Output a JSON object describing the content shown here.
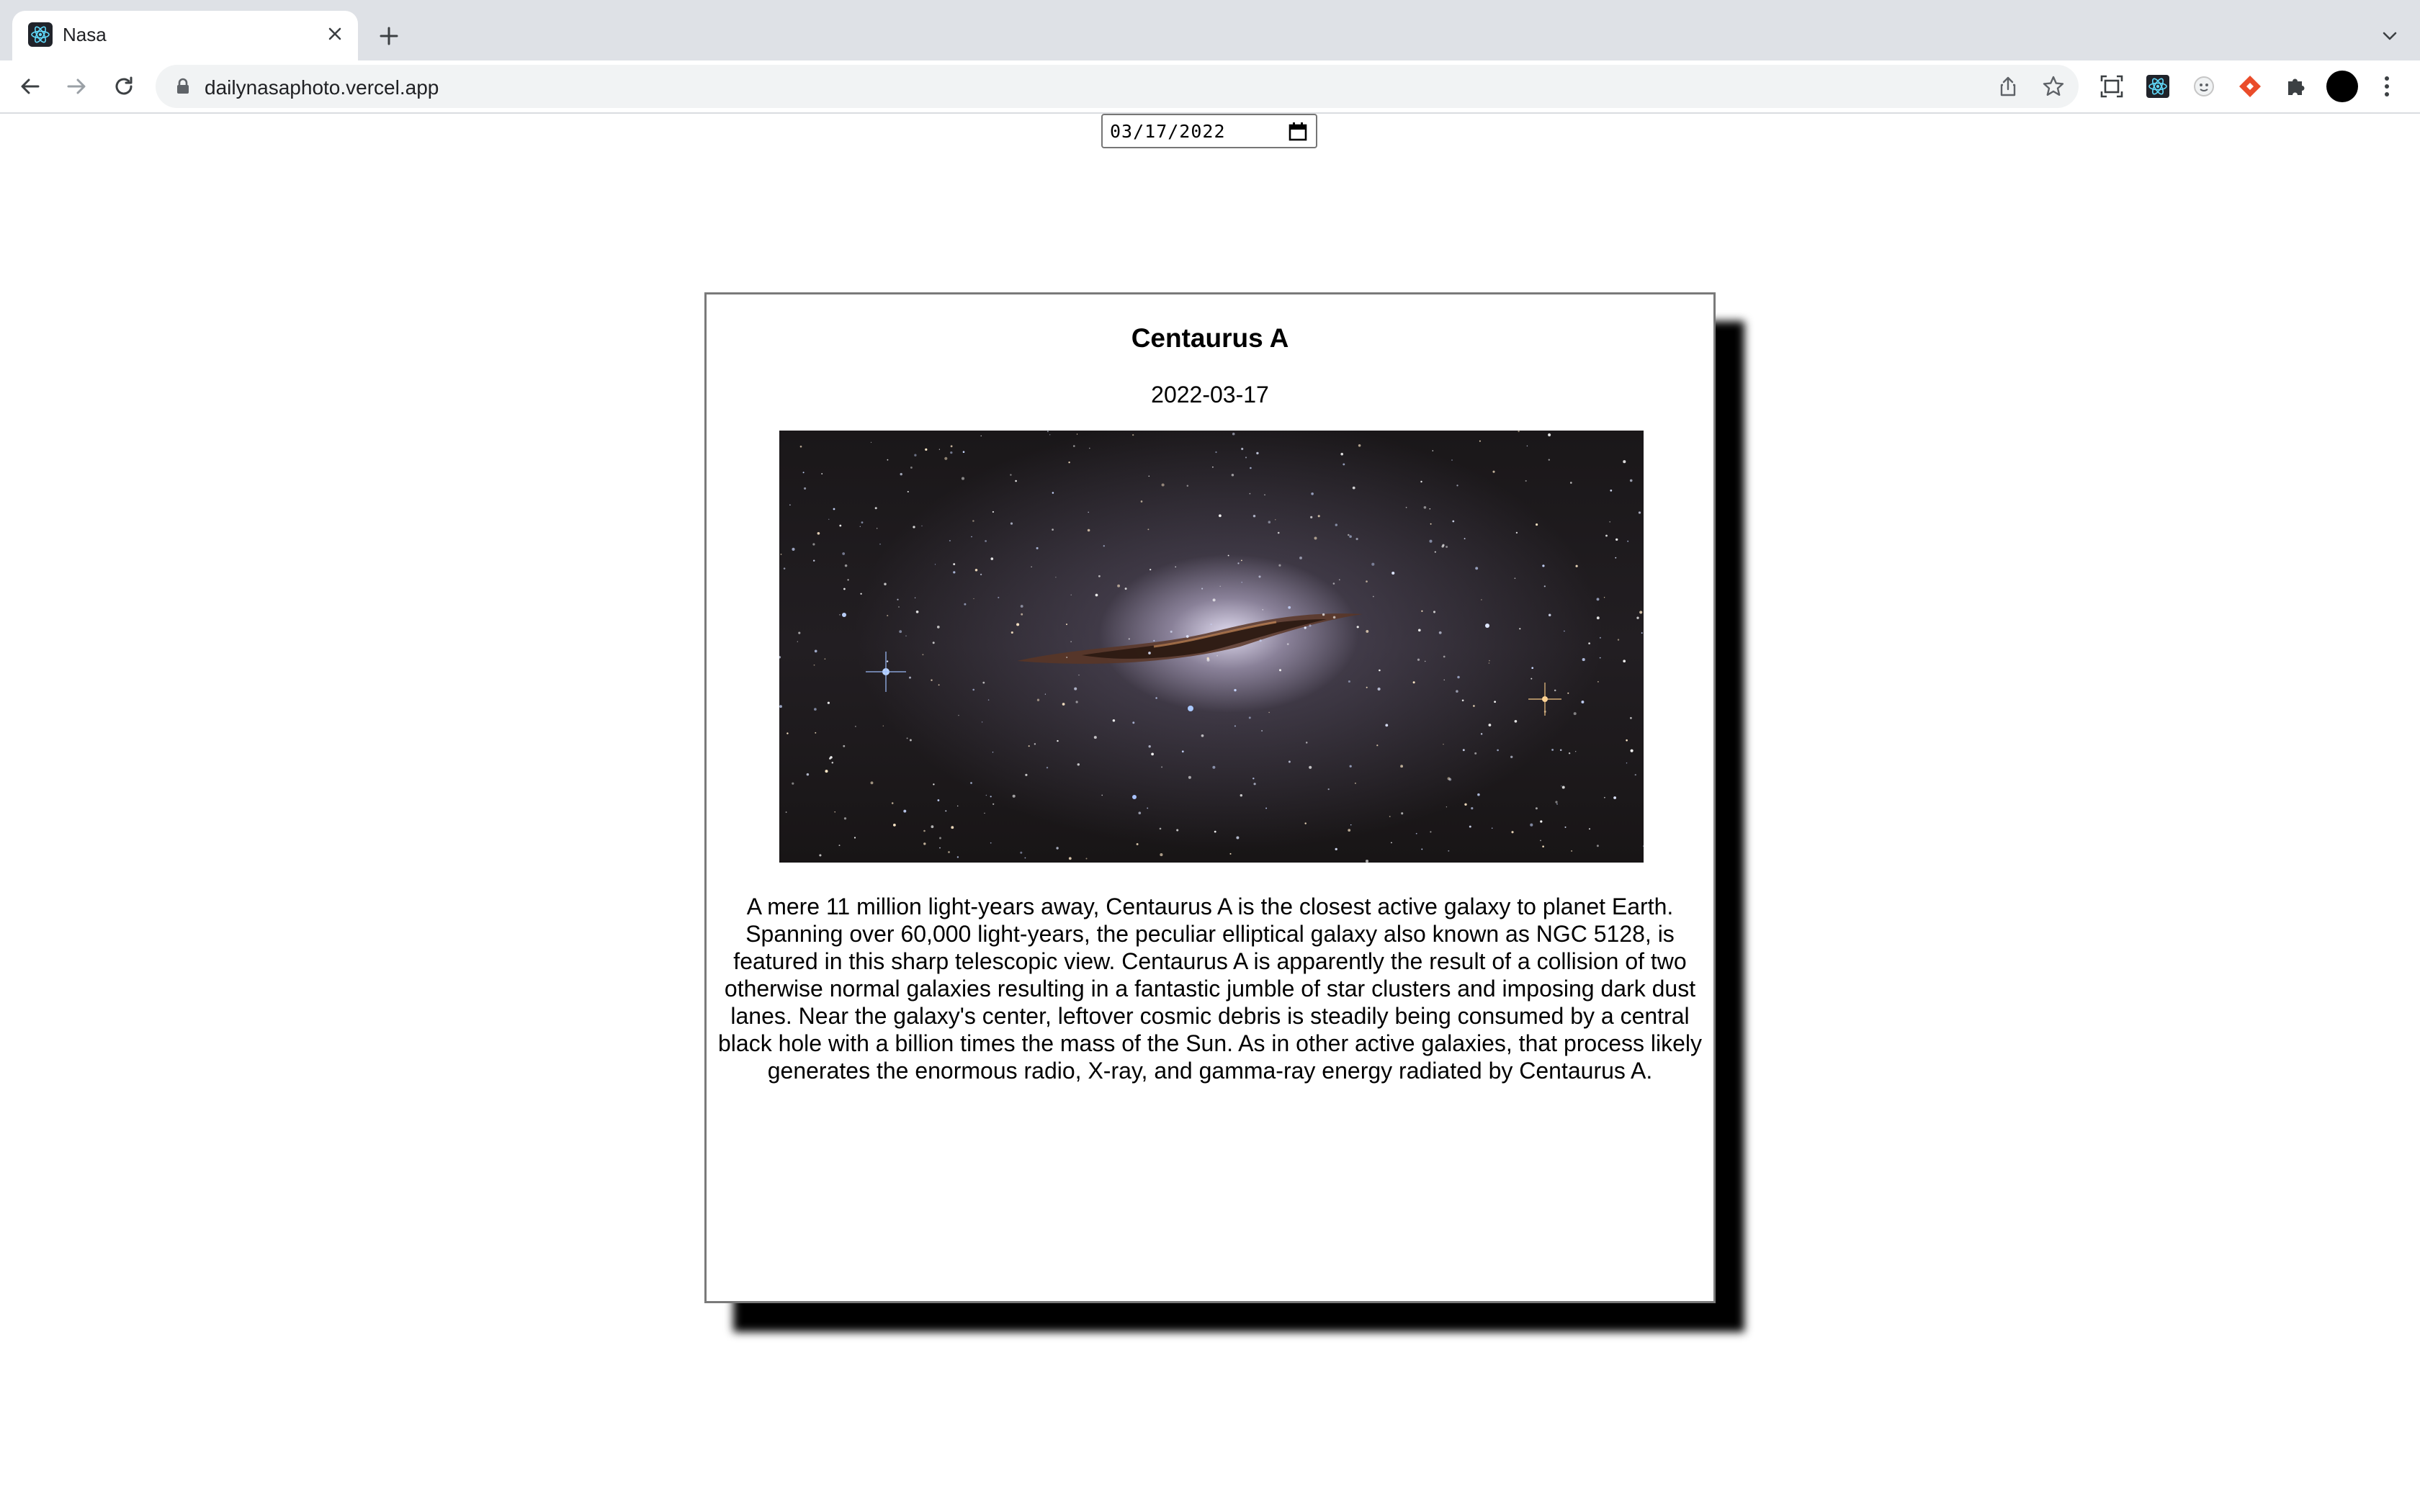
{
  "browser": {
    "tab": {
      "title": "Nasa",
      "favicon_icon": "react-atom-icon"
    },
    "address_bar": {
      "url": "dailynasaphoto.vercel.app"
    }
  },
  "page": {
    "date_picker": {
      "value": "03/17/2022"
    },
    "apod": {
      "title": "Centaurus A",
      "date": "2022-03-17",
      "image_alt": "Centaurus A galaxy",
      "explanation": "A mere 11 million light-years away, Centaurus A is the closest active galaxy to planet Earth. Spanning over 60,000 light-years, the peculiar elliptical galaxy also known as NGC 5128, is featured in this sharp telescopic view. Centaurus A is apparently the result of a collision of two otherwise normal galaxies resulting in a fantastic jumble of star clusters and imposing dark dust lanes. Near the galaxy's center, leftover cosmic debris is steadily being consumed by a central black hole with a billion times the mass of the Sun. As in other active galaxies, that process likely generates the enormous radio, X-ray, and gamma-ray energy radiated by Centaurus A."
    }
  }
}
